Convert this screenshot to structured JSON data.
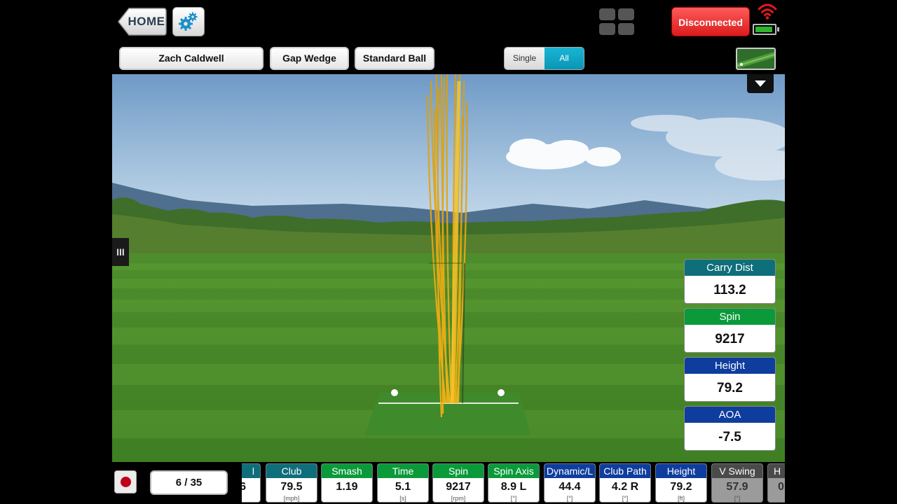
{
  "topbar": {
    "home_label": "HOME",
    "connection_status": "Disconnected",
    "icons": [
      "gear-icon",
      "grid-view-icon",
      "wifi-signal-icon",
      "battery-icon"
    ]
  },
  "selectors": {
    "player": "Zach Caldwell",
    "club": "Gap Wedge",
    "ball": "Standard Ball",
    "view_single": "Single",
    "view_all": "All",
    "view_selected": "All"
  },
  "scene": {
    "side_handle": "III"
  },
  "stats": [
    {
      "label": "Carry Dist",
      "value": "113.2",
      "color": "#0e6e7a"
    },
    {
      "label": "Spin",
      "value": "9217",
      "color": "#0a9a3a"
    },
    {
      "label": "Height",
      "value": "79.2",
      "color": "#0f3d9e"
    },
    {
      "label": "AOA",
      "value": "-7.5",
      "color": "#0f3d9e"
    }
  ],
  "bottom": {
    "shot_counter": "6 / 35",
    "metrics": [
      {
        "label": "l",
        "value": "6",
        "unit": "",
        "color": "#0e6e7a"
      },
      {
        "label": "Club",
        "value": "79.5",
        "unit": "[mph]",
        "color": "#0e6e7a"
      },
      {
        "label": "Smash",
        "value": "1.19",
        "unit": "",
        "color": "#0a9a3a"
      },
      {
        "label": "Time",
        "value": "5.1",
        "unit": "[s]",
        "color": "#0a9a3a"
      },
      {
        "label": "Spin",
        "value": "9217",
        "unit": "[rpm]",
        "color": "#0a9a3a"
      },
      {
        "label": "Spin Axis",
        "value": "8.9 L",
        "unit": "[°]",
        "color": "#0a9a3a"
      },
      {
        "label": "Dynamic/L",
        "value": "44.4",
        "unit": "[°]",
        "color": "#0f3d9e"
      },
      {
        "label": "Club Path",
        "value": "4.2 R",
        "unit": "[°]",
        "color": "#0f3d9e"
      },
      {
        "label": "Height",
        "value": "79.2",
        "unit": "[ft]",
        "color": "#0f3d9e"
      },
      {
        "label": "V Swing",
        "value": "57.9",
        "unit": "[°]",
        "color": "#4a4a4a"
      },
      {
        "label": "H",
        "value": "0",
        "unit": "",
        "color": "#4a4a4a"
      }
    ]
  }
}
